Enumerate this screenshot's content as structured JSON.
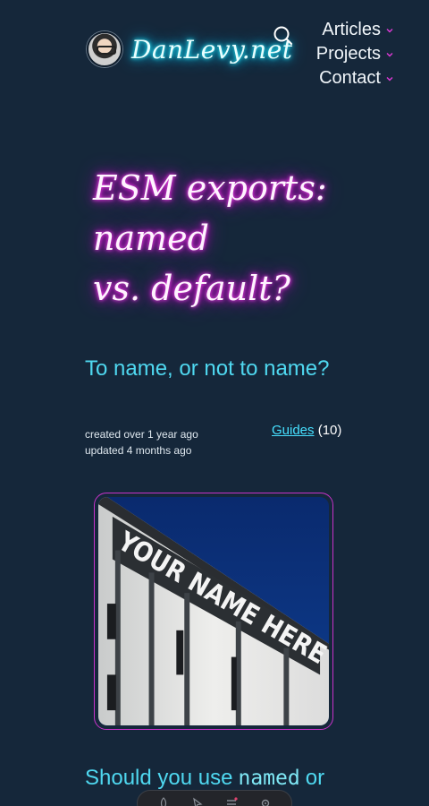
{
  "header": {
    "brand": "DanLevy.net",
    "nav": [
      {
        "label": "Articles"
      },
      {
        "label": "Projects"
      },
      {
        "label": "Contact"
      }
    ]
  },
  "article": {
    "title_lines": [
      "ESM exports:",
      "named",
      "vs. default?"
    ],
    "subtitle": "To name, or not to name?",
    "created": "created over 1 year ago",
    "updated": "updated 4 months ago",
    "category": {
      "label": "Guides",
      "count": "(10)"
    },
    "hero_sign_text": "YOUR NAME HERE",
    "section_heading": {
      "before": "Should you use",
      "code": "named",
      "after": "or"
    }
  },
  "colors": {
    "background": "#15273a",
    "cyan_glow": "#00d9ff",
    "magenta_glow": "#e100d6",
    "accent_text": "#4fd8f0",
    "image_border": "#c733c9"
  },
  "icons": {
    "search": "search-icon",
    "chevron": "chevron-down-icon"
  }
}
